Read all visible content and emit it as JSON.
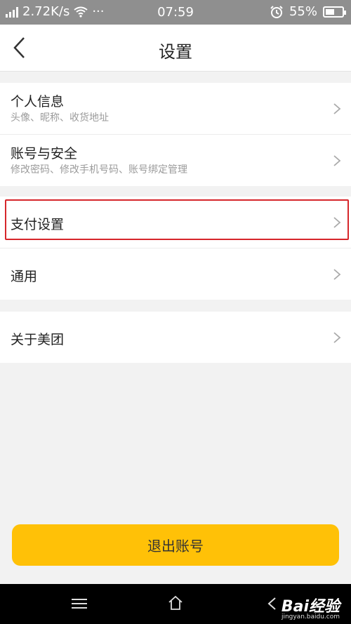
{
  "status_bar": {
    "net_speed": "2.72K/s",
    "more": "···",
    "time": "07:59",
    "battery": "55%",
    "battery_level": 0.55
  },
  "header": {
    "title": "设置"
  },
  "groups": [
    {
      "items": [
        {
          "label": "个人信息",
          "sub": "头像、昵称、收货地址"
        },
        {
          "label": "账号与安全",
          "sub": "修改密码、修改手机号码、账号绑定管理"
        }
      ]
    },
    {
      "items": [
        {
          "label": "支付设置"
        },
        {
          "label": "通用"
        }
      ]
    },
    {
      "items": [
        {
          "label": "关于美团"
        }
      ]
    }
  ],
  "logout_label": "退出账号",
  "watermark": {
    "text": "Bai经验",
    "domain": "jingyan.baidu.com"
  },
  "colors": {
    "accent": "#ffc107",
    "highlight": "#d6262b",
    "statusbar": "#8f8f8f"
  }
}
